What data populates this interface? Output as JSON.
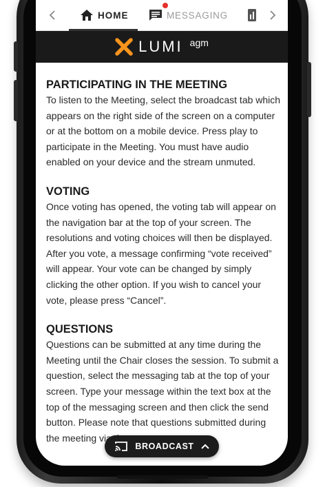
{
  "nav": {
    "tabs": [
      {
        "label": "HOME",
        "icon": "home-icon",
        "active": true
      },
      {
        "label": "MESSAGING",
        "icon": "chat-icon",
        "active": false,
        "has_notification": true
      }
    ],
    "notification_color": "#e4312b"
  },
  "brand": {
    "name": "LUMI",
    "suffix": "agm",
    "accent": "#f7941d"
  },
  "sections": [
    {
      "heading": "PARTICIPATING IN THE MEETING",
      "body": "To listen to the Meeting, select the broadcast tab which appears on the right side of the screen on a computer or at the bottom on a mobile device. Press play to participate in the Meeting. You must have audio enabled on your device and the stream unmuted."
    },
    {
      "heading": "VOTING",
      "body": "Once voting has opened, the voting tab will appear on the navigation bar at the top of your screen. The resolutions and voting choices will then be displayed. After you vote, a message confirming “vote received” will appear. Your vote can be changed by simply clicking the other option. If you wish to cancel your vote, please press “Cancel”."
    },
    {
      "heading": "QUESTIONS",
      "body": "Questions can be submitted at any time during the Meeting until the Chair closes the session. To submit a question, select the messaging tab at the top of your screen. Type your message within the text box at the top of the messaging screen and then click the send button. Please note that questions submitted during the meeting via the"
    }
  ],
  "broadcast": {
    "label": "BROADCAST",
    "icon": "cast-icon"
  }
}
